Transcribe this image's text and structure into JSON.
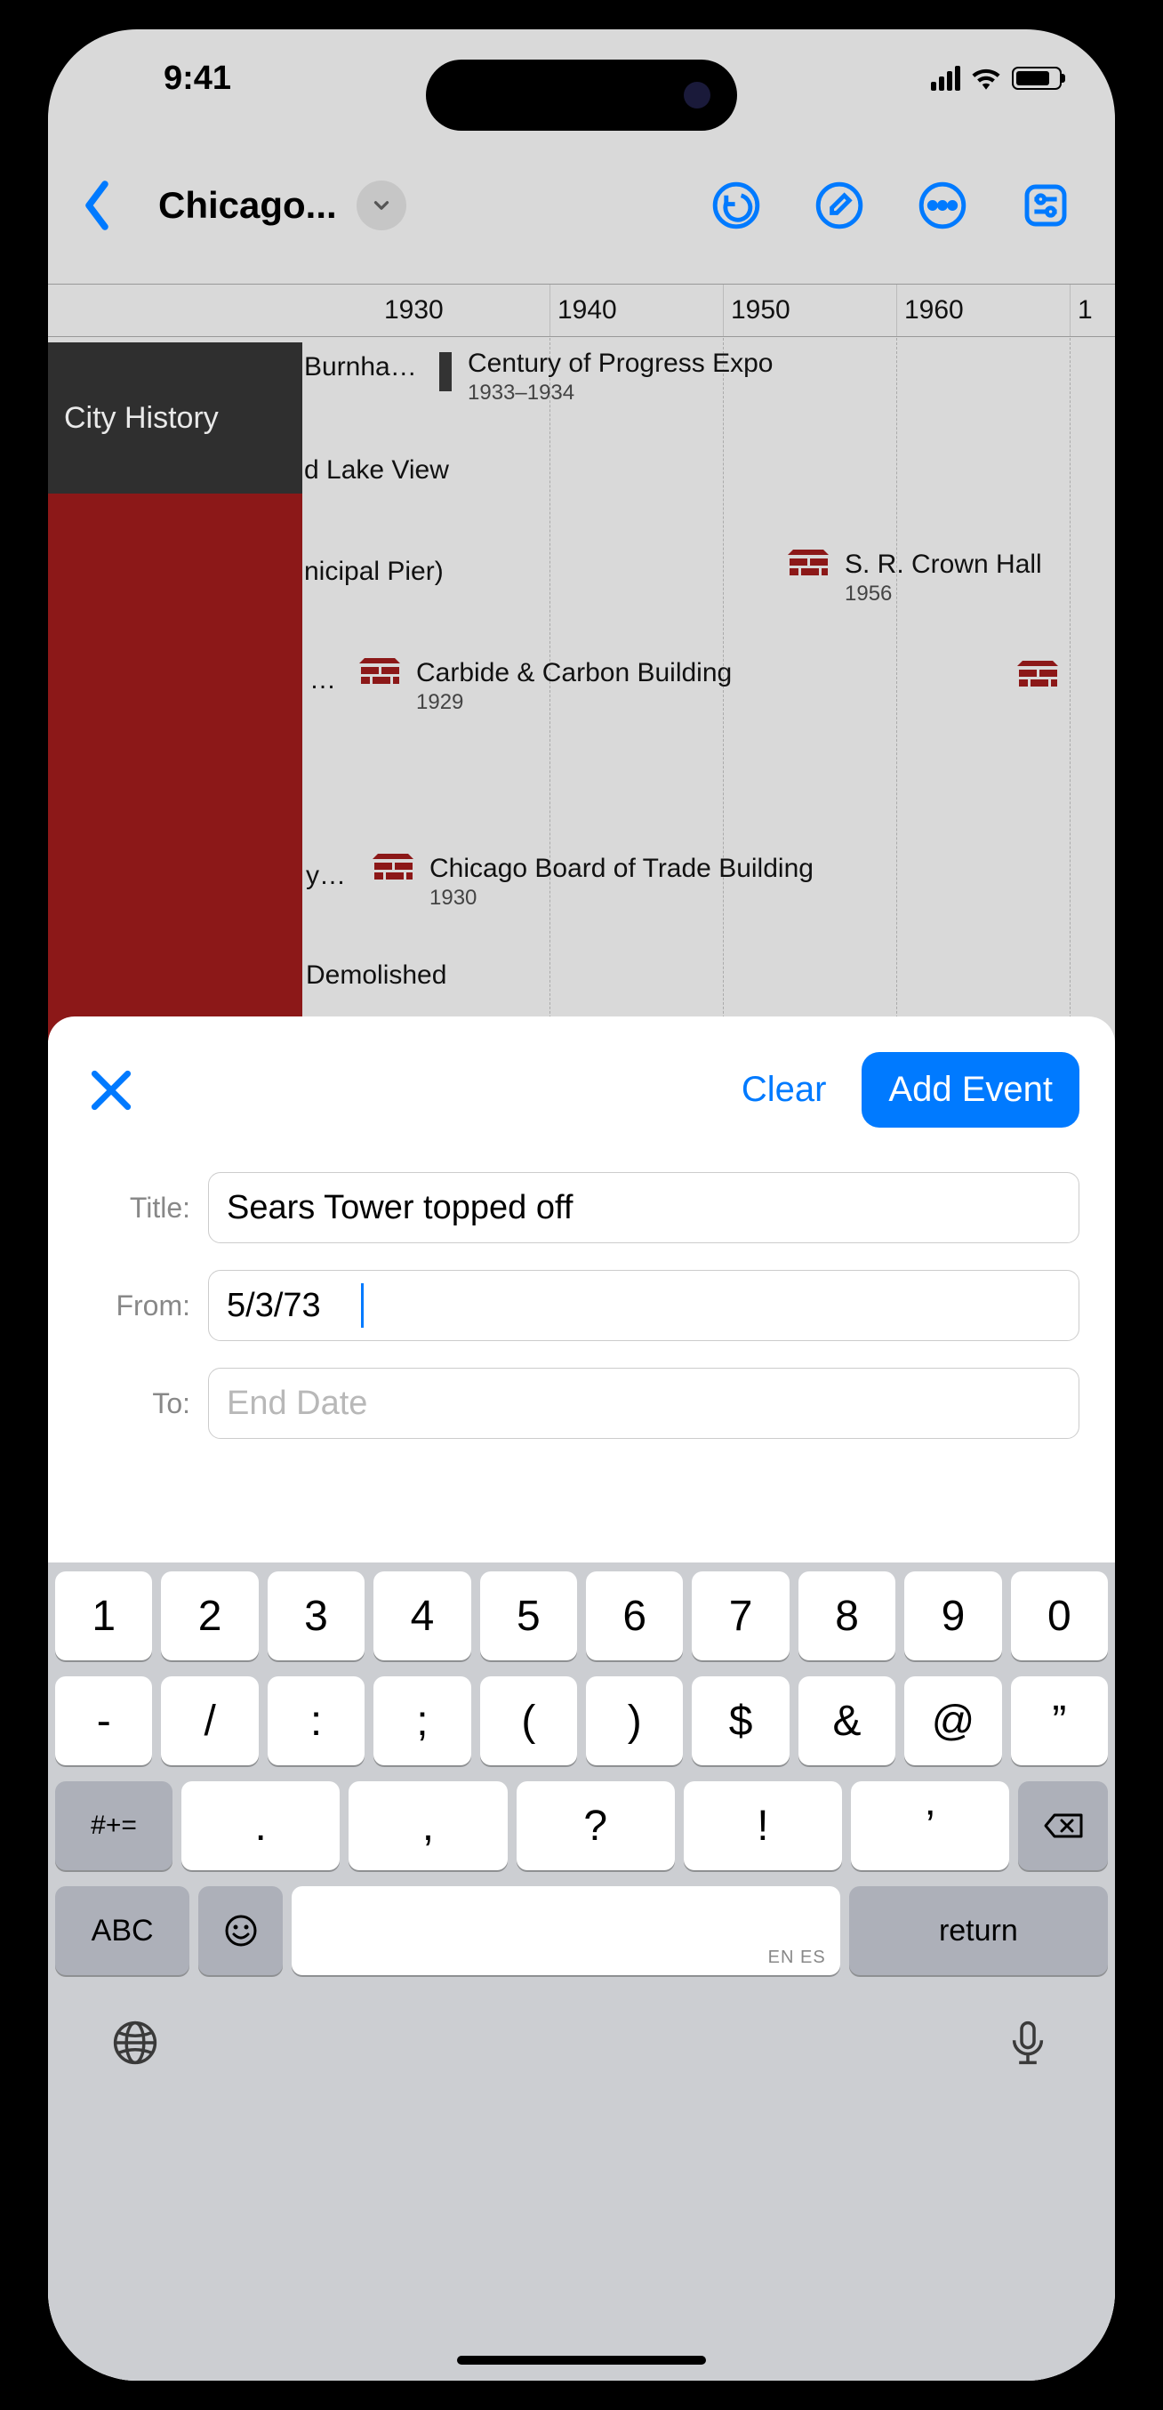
{
  "status": {
    "time": "9:41"
  },
  "nav": {
    "title": "Chicago..."
  },
  "ruler": [
    "1930",
    "1940",
    "1950",
    "1960"
  ],
  "left_section": {
    "label": "City History"
  },
  "events": {
    "burnham": "Burnha…",
    "century": {
      "title": "Century of Progress Expo",
      "sub": "1933–1934"
    },
    "lakeview": "d Lake View",
    "pier": "nicipal Pier)",
    "crown": {
      "title": "S. R. Crown Hall",
      "sub": "1956"
    },
    "carbide": {
      "title": "Carbide & Carbon Building",
      "sub": "1929"
    },
    "trade": {
      "title": "Chicago Board of Trade Building",
      "sub": "1930"
    },
    "y": "y…",
    "demolished": "Demolished"
  },
  "sheet": {
    "clear": "Clear",
    "add": "Add Event",
    "title_label": "Title:",
    "title_value": "Sears Tower topped off",
    "from_label": "From:",
    "from_value": "5/3/73",
    "to_label": "To:",
    "to_placeholder": "End Date"
  },
  "keyboard": {
    "row1": [
      "1",
      "2",
      "3",
      "4",
      "5",
      "6",
      "7",
      "8",
      "9",
      "0"
    ],
    "row2": [
      "-",
      "/",
      ":",
      ";",
      "(",
      ")",
      "$",
      "&",
      "@",
      "”"
    ],
    "row3_shift": "#+=",
    "row3": [
      ".",
      ",",
      "?",
      "!",
      "’"
    ],
    "abc": "ABC",
    "return": "return",
    "space_hint": "EN ES"
  }
}
